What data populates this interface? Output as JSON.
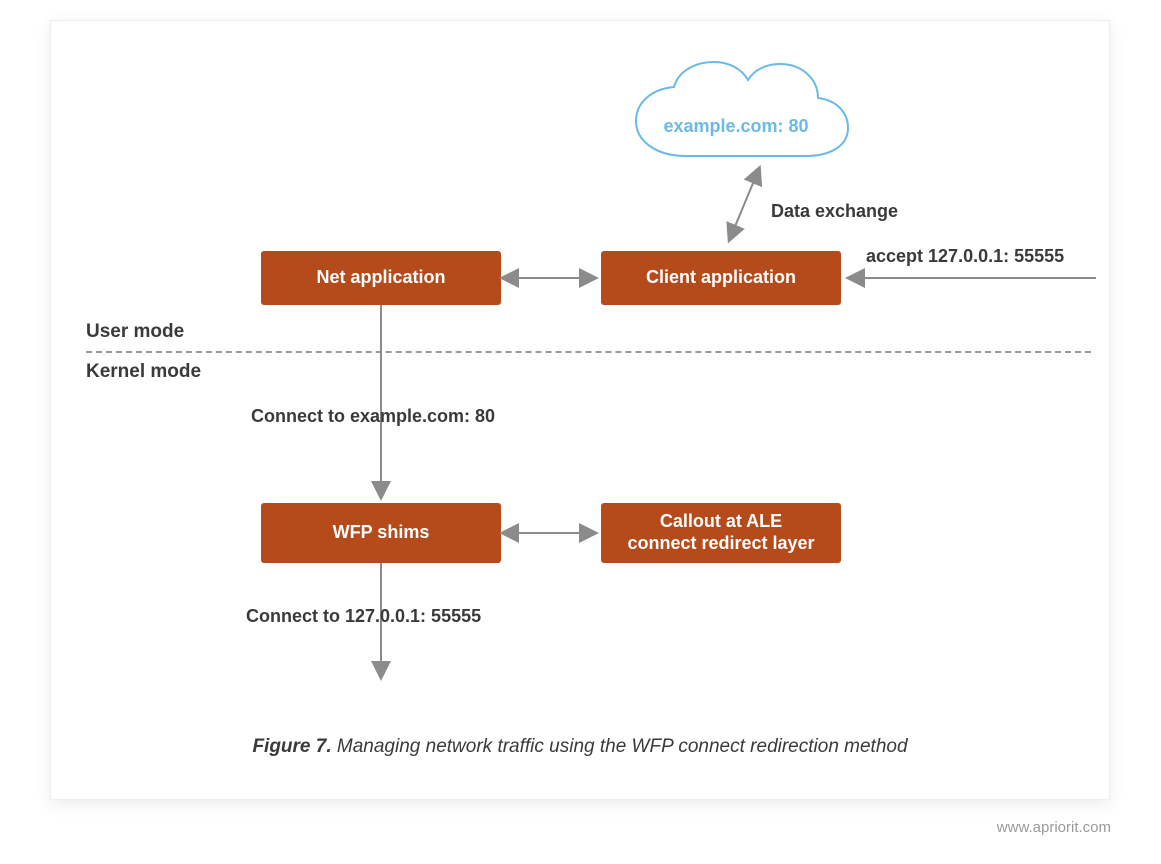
{
  "modes": {
    "user": "User mode",
    "kernel": "Kernel mode"
  },
  "cloud": "example.com: 80",
  "boxes": {
    "net_app": "Net application",
    "client_app": "Client application",
    "wfp_shims": "WFP shims",
    "callout": "Callout at ALE\nconnect redirect layer"
  },
  "labels": {
    "data_exchange": "Data exchange",
    "accept": "accept 127.0.0.1: 55555",
    "connect80": "Connect to example.com: 80",
    "connect55": "Connect to 127.0.0.1: 55555"
  },
  "caption": {
    "figure": "Figure 7.",
    "title": " Managing network traffic using the WFP connect redirection method"
  },
  "footer": "www.apriorit.com",
  "arrow_color": "#8b8b8b"
}
